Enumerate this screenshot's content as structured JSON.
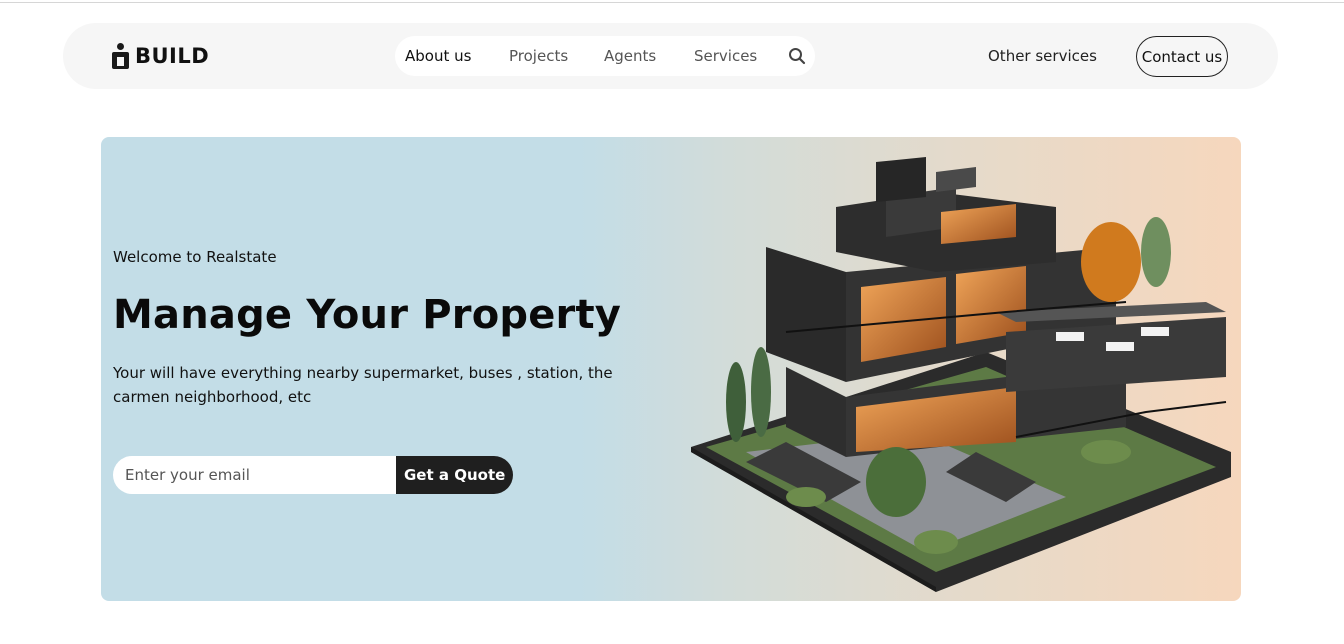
{
  "brand": {
    "name": "BUILD",
    "logo_icon": "person-block-logo"
  },
  "nav": {
    "links": [
      {
        "label": "About us"
      },
      {
        "label": "Projects"
      },
      {
        "label": "Agents"
      },
      {
        "label": "Services"
      }
    ],
    "search_icon": "search-icon",
    "other_services": "Other services",
    "contact": "Contact us"
  },
  "hero": {
    "welcome": "Welcome to Realstate",
    "title": "Manage Your Property",
    "description": "Your will have everything nearby supermarket, buses , station, the carmen neighborhood, etc",
    "email_placeholder": "Enter your email",
    "cta": "Get a Quote",
    "image": "modern-house-illustration"
  },
  "colors": {
    "hero_left": "#c3dde7",
    "hero_right": "#f6d7bd",
    "button_dark": "#1f1f1f",
    "nav_bg": "#f6f6f6"
  }
}
